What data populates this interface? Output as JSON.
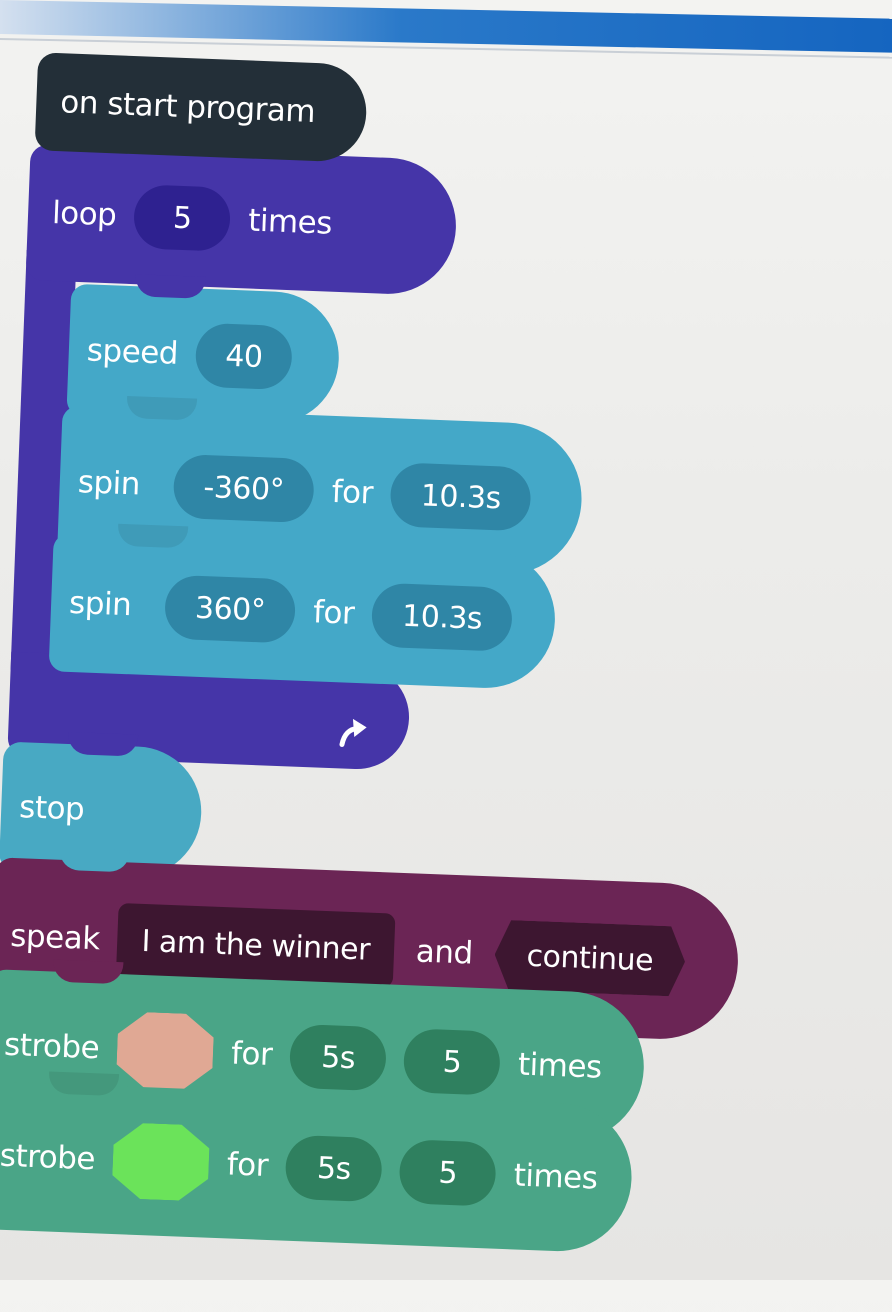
{
  "program": {
    "hat_label": "on start program",
    "loop": {
      "label": "loop",
      "count": "5",
      "suffix": "times"
    },
    "speed": {
      "label": "speed",
      "value": "40"
    },
    "spin_1": {
      "label": "spin",
      "angle": "-360°",
      "for_label": "for",
      "duration": "10.3s"
    },
    "spin_2": {
      "label": "spin",
      "angle": "360°",
      "for_label": "for",
      "duration": "10.3s"
    },
    "stop": {
      "label": "stop"
    },
    "speak": {
      "label": "speak",
      "text": "I am the winner",
      "and_label": "and",
      "mode": "continue"
    },
    "strobe_1": {
      "label": "strobe",
      "color": "#e0a894",
      "for_label": "for",
      "duration": "5s",
      "count": "5",
      "suffix": "times"
    },
    "strobe_2": {
      "label": "strobe",
      "color": "#6be35a",
      "for_label": "for",
      "duration": "5s",
      "count": "5",
      "suffix": "times"
    }
  },
  "colors": {
    "hat": "#232f38",
    "loop": "#4535a8",
    "motion": "#44a8c8",
    "speak": "#6b2555",
    "lights": "#4aa587"
  },
  "icons": {
    "loop_end": "loop-return-arrow-icon"
  }
}
